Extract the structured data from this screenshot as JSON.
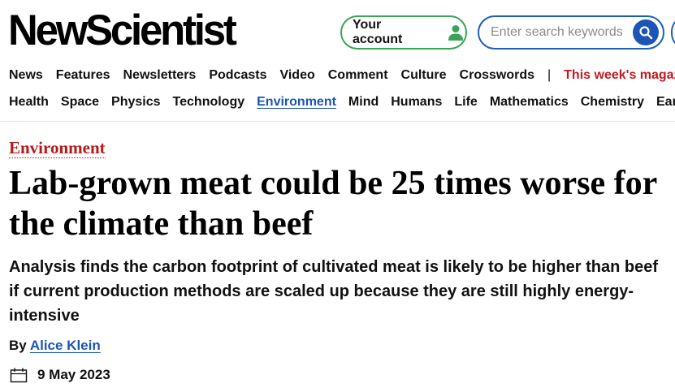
{
  "header": {
    "logo_text": "NewScientist",
    "account_label": "Your account",
    "account_icon": "person-icon",
    "search": {
      "placeholder": "Enter search keywords",
      "icon": "search-icon"
    }
  },
  "nav": {
    "primary": [
      "News",
      "Features",
      "Newsletters",
      "Podcasts",
      "Video",
      "Comment",
      "Culture",
      "Crosswords"
    ],
    "separator": "|",
    "magazine_label": "This week's magazine",
    "secondary": [
      "Health",
      "Space",
      "Physics",
      "Technology",
      "Environment",
      "Mind",
      "Humans",
      "Life",
      "Mathematics",
      "Chemistry",
      "Earth"
    ],
    "active": "Environment"
  },
  "article": {
    "category": "Environment",
    "headline": "Lab-grown meat could be 25 times worse for the climate than beef",
    "standfirst": "Analysis finds the carbon footprint of cultivated meat is likely to be higher than beef if current production methods are scaled up because they are still highly energy-intensive",
    "byline_prefix": "By",
    "author": "Alice Klein",
    "date": "9 May 2023",
    "date_icon": "calendar-icon"
  },
  "colors": {
    "account_border": "#3aa357",
    "search_border": "#1d5fb3",
    "link_blue": "#1d55b5",
    "magazine_red": "#c4191f",
    "category_red": "#b31b1b"
  }
}
